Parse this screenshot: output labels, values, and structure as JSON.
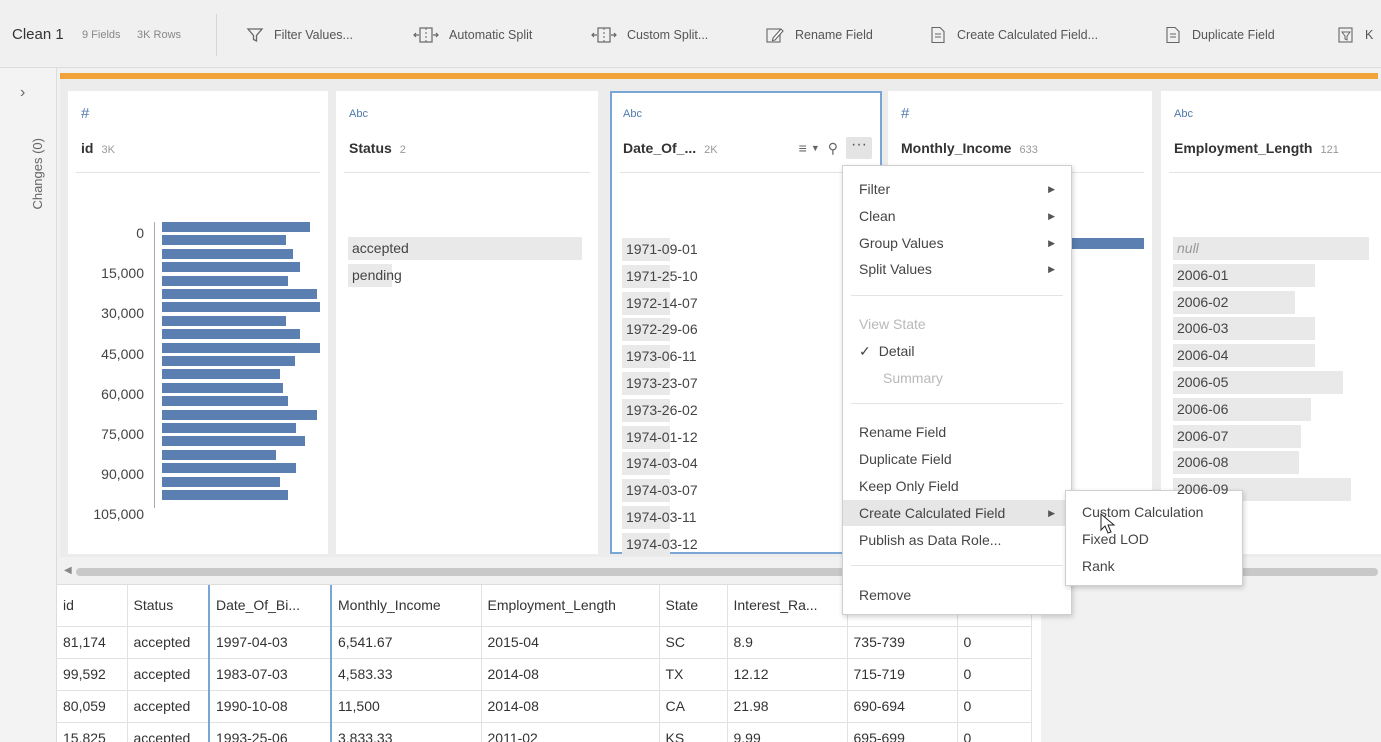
{
  "toolbar": {
    "title": "Clean 1",
    "fields": "9 Fields",
    "rows": "3K Rows",
    "buttons": {
      "filter": "Filter Values...",
      "auto_split": "Automatic Split",
      "custom_split": "Custom Split...",
      "rename": "Rename Field",
      "calc": "Create Calculated Field...",
      "duplicate": "Duplicate Field",
      "keep": "K"
    }
  },
  "side": {
    "changes": "Changes (0)",
    "expand": "›"
  },
  "cards": {
    "id": {
      "type": "#",
      "name": "id",
      "count": "3K",
      "ticks": [
        "0",
        "15,000",
        "30,000",
        "45,000",
        "60,000",
        "75,000",
        "90,000",
        "105,000"
      ],
      "bars": [
        0.88,
        0.74,
        0.78,
        0.82,
        0.75,
        0.92,
        0.94,
        0.74,
        0.82,
        0.94,
        0.79,
        0.7,
        0.72,
        0.75,
        0.92,
        0.8,
        0.85,
        0.68,
        0.8,
        0.7,
        0.75
      ]
    },
    "status": {
      "type": "Abc",
      "name": "Status",
      "count": "2",
      "values": [
        "accepted",
        "pending"
      ]
    },
    "dob": {
      "type": "Abc",
      "name": "Date_Of_...",
      "count": "2K",
      "values": [
        "1971-09-01",
        "1971-25-10",
        "1972-14-07",
        "1972-29-06",
        "1973-06-11",
        "1973-23-07",
        "1973-26-02",
        "1974-01-12",
        "1974-03-04",
        "1974-03-07",
        "1974-03-11",
        "1974-03-12"
      ]
    },
    "income": {
      "type": "#",
      "name": "Monthly_Income",
      "count": "633"
    },
    "emp": {
      "type": "Abc",
      "name": "Employment_Length",
      "count": "121",
      "values": [
        "null",
        "2006-01",
        "2006-02",
        "2006-03",
        "2006-04",
        "2006-05",
        "2006-06",
        "2006-07",
        "2006-08",
        "2006-09"
      ]
    }
  },
  "grid": {
    "headers": [
      "id",
      "Status",
      "Date_Of_Bi...",
      "Monthly_Income",
      "Employment_Length",
      "State",
      "Interest_Ra...",
      "",
      ""
    ],
    "rows": [
      [
        "81,174",
        "accepted",
        "1997-04-03",
        "6,541.67",
        "2015-04",
        "SC",
        "8.9",
        "735-739",
        "0"
      ],
      [
        "99,592",
        "accepted",
        "1983-07-03",
        "4,583.33",
        "2014-08",
        "TX",
        "12.12",
        "715-719",
        "0"
      ],
      [
        "80,059",
        "accepted",
        "1990-10-08",
        "11,500",
        "2014-08",
        "CA",
        "21.98",
        "690-694",
        "0"
      ],
      [
        "15,825",
        "accepted",
        "1993-25-06",
        "3,833.33",
        "2011-02",
        "KS",
        "9.99",
        "695-699",
        "0"
      ]
    ]
  },
  "menu": {
    "filter": "Filter",
    "clean": "Clean",
    "group": "Group Values",
    "split": "Split Values",
    "view_state": "View State",
    "detail": "Detail",
    "summary": "Summary",
    "rename": "Rename Field",
    "duplicate": "Duplicate Field",
    "keep_only": "Keep Only Field",
    "create_calc": "Create Calculated Field",
    "publish": "Publish as Data Role...",
    "remove": "Remove"
  },
  "submenu": {
    "custom": "Custom Calculation",
    "fixed": "Fixed LOD",
    "rank": "Rank"
  },
  "colors": {
    "accent_orange": "#f2a33a",
    "bar_blue": "#5a7fb0",
    "selected_border": "#7aa6d6"
  }
}
